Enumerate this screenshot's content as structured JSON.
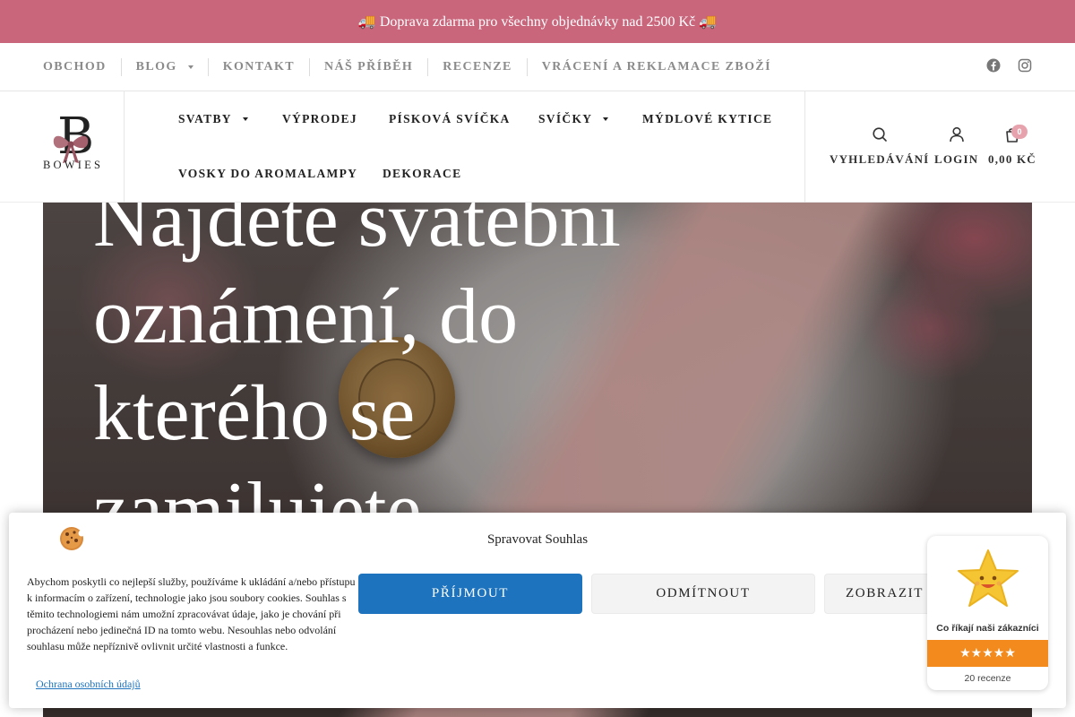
{
  "announcement": {
    "text": "🚚 Doprava zdarma pro všechny objednávky nad 2500 Kč 🚚"
  },
  "secondary_nav": {
    "items": [
      {
        "label": "OBCHOD"
      },
      {
        "label": "BLOG"
      },
      {
        "label": "KONTAKT"
      },
      {
        "label": "NÁŠ PŘÍBĚH"
      },
      {
        "label": "RECENZE"
      },
      {
        "label": "VRÁCENÍ A REKLAMACE ZBOŽÍ"
      }
    ],
    "social": [
      "facebook-icon",
      "instagram-icon"
    ]
  },
  "logo": {
    "letter": "B",
    "word": "BOWIES"
  },
  "main_nav": {
    "items": [
      {
        "label": "SVATBY"
      },
      {
        "label": "VÝPRODEJ"
      },
      {
        "label": "PÍSKOVÁ SVÍČKA"
      },
      {
        "label": "SVÍČKY"
      },
      {
        "label": "MÝDLOVÉ KYTICE"
      },
      {
        "label": "VOSKY DO AROMALAMPY"
      },
      {
        "label": "DEKORACE"
      }
    ]
  },
  "tools": {
    "search_label": "VYHLEDÁVÁNÍ",
    "login_label": "LOGIN",
    "cart_total": "0,00 KČ",
    "cart_count": "0"
  },
  "hero": {
    "title": "Najděte svatební oznámení, do kterého se zamilujete"
  },
  "consent": {
    "title": "Spravovat Souhlas",
    "text": "Abychom poskytli co nejlepší služby, používáme k ukládání a/nebo přístupu k informacím o zařízení, technologie jako jsou soubory cookies. Souhlas s těmito technologiemi nám umožní zpracovávat údaje, jako je chování při procházení nebo jedinečná ID na tomto webu. Nesouhlas nebo odvolání souhlasu může nepříznivě ovlivnit určité vlastnosti a funkce.",
    "accept": "PŘÍJMOUT",
    "deny": "ODMÍTNOUT",
    "show": "ZOBRAZIT",
    "privacy": "Ochrana osobních údajů",
    "close": "×"
  },
  "reviews_widget": {
    "title": "Co říkají naši zákazníci",
    "stars": "★★★★★",
    "count": "20 recenze"
  },
  "colors": {
    "topbar": "#c9667c",
    "accent_button": "#1e73be",
    "widget_orange": "#f38a1e"
  }
}
